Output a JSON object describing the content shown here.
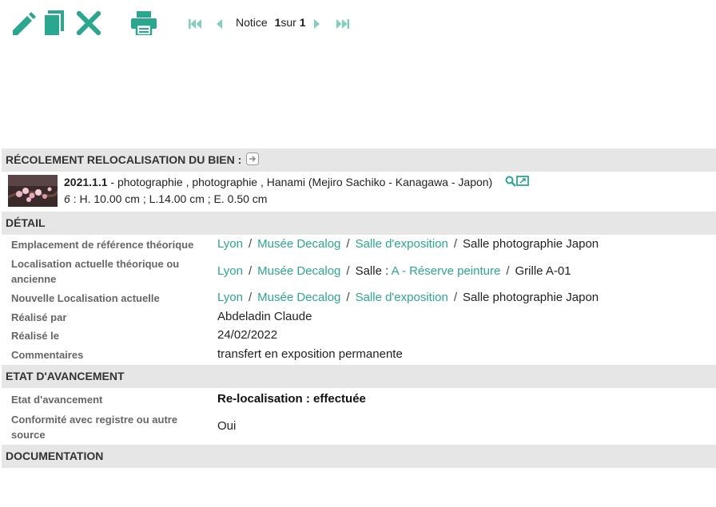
{
  "toolbar": {
    "icons": [
      "pencil-icon",
      "copy-icon",
      "close-icon",
      "print-icon"
    ],
    "nav": {
      "label": "Notice",
      "current": "1",
      "of": "sur",
      "total": "1"
    }
  },
  "colors": {
    "accent": "#2aa88f",
    "header_bg": "#e6e6e6",
    "label": "#666666"
  },
  "recolement": {
    "title": "RÉCOLEMENT RELOCALISATION DU BIEN :",
    "object": {
      "inventory": "2021.1.1",
      "description": " - photographie , photographie , Hanami (Mejiro Sachiko - Kanagawa - Japon)",
      "dim_prefix": "6",
      "dimensions": " : H. 10.00 cm ; L.14.00 cm ; E. 0.50 cm"
    }
  },
  "detail": {
    "title": "DÉTAIL",
    "rows": {
      "ref_label": "Emplacement de référence théorique",
      "ref_path": [
        "Lyon",
        "Musée Decalog",
        "Salle d'exposition",
        "Salle photographie Japon"
      ],
      "cur_label": "Localisation actuelle théorique ou ancienne",
      "cur_path": [
        "Lyon",
        "Musée Decalog",
        "Salle : ",
        "A - Réserve peinture",
        "Grille A-01"
      ],
      "new_label": "Nouvelle Localisation actuelle",
      "new_path": [
        "Lyon",
        "Musée Decalog",
        "Salle d'exposition",
        "Salle photographie Japon"
      ],
      "by_label": "Réalisé par",
      "by_value": "Abdeladin Claude",
      "date_label": "Réalisé le",
      "date_value": "24/02/2022",
      "comment_label": "Commentaires",
      "comment_value": "transfert en exposition permanente"
    }
  },
  "etat": {
    "title": "ETAT D'AVANCEMENT",
    "status_label": "Etat d'avancement",
    "status_value": "Re-localisation : effectuée",
    "conf_label": "Conformité avec registre ou autre source",
    "conf_value": "Oui"
  },
  "documentation": {
    "title": "DOCUMENTATION"
  }
}
